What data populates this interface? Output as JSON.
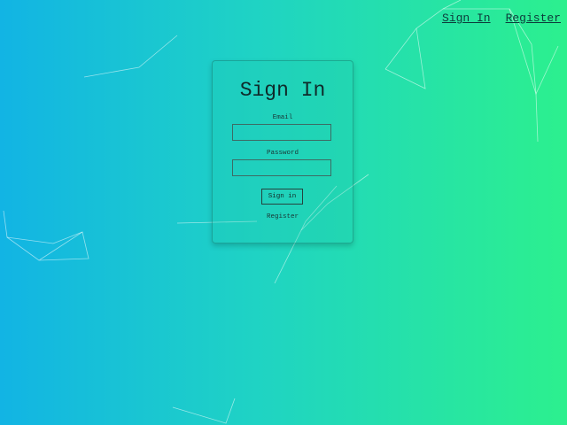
{
  "nav": {
    "sign_in": "Sign In",
    "register": "Register"
  },
  "form": {
    "title": "Sign In",
    "email_label": "Email",
    "email_value": "",
    "password_label": "Password",
    "password_value": "",
    "submit_label": "Sign in",
    "register_link": "Register"
  },
  "colors": {
    "gradient_start": "#12b4e4",
    "gradient_end": "#2cf08e"
  }
}
